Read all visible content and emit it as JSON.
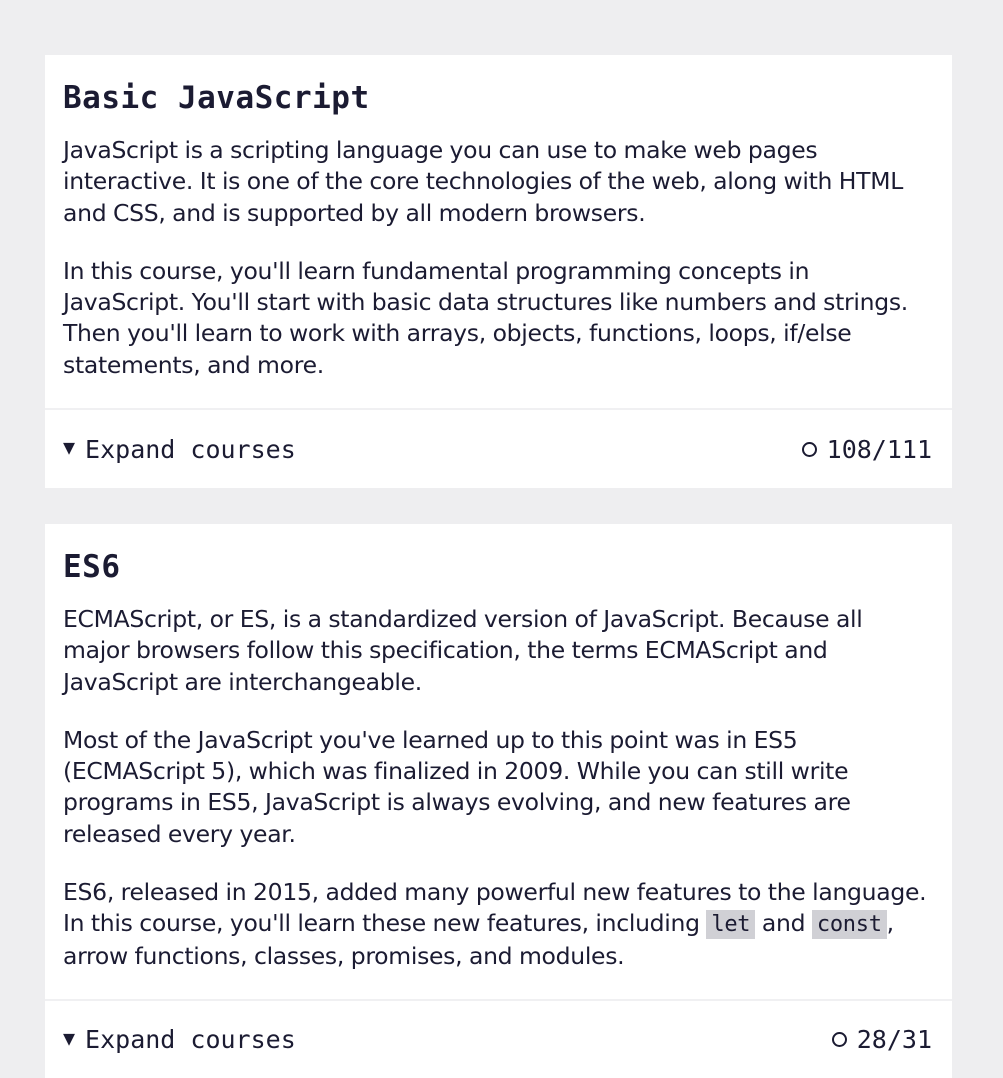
{
  "courses": [
    {
      "title": "Basic JavaScript",
      "paragraphs": [
        "JavaScript is a scripting language you can use to make web pages interactive. It is one of the core technologies of the web, along with HTML and CSS, and is supported by all modern browsers.",
        "In this course, you'll learn fundamental programming concepts in JavaScript. You'll start with basic data structures like numbers and strings. Then you'll learn to work with arrays, objects, functions, loops, if/else statements, and more."
      ],
      "expand_label": "Expand courses",
      "progress": "108/111"
    },
    {
      "title": "ES6",
      "paragraphs": [
        "ECMAScript, or ES, is a standardized version of JavaScript. Because all major browsers follow this specification, the terms ECMAScript and JavaScript are interchangeable.",
        "Most of the JavaScript you've learned up to this point was in ES5 (ECMAScript 5), which was finalized in 2009. While you can still write programs in ES5, JavaScript is always evolving, and new features are released every year."
      ],
      "p3": {
        "before": "ES6, released in 2015, added many powerful new features to the language. In this course, you'll learn these new features, including ",
        "code1": "let",
        "mid": " and ",
        "code2": "const",
        "after": ", arrow functions, classes, promises, and modules."
      },
      "expand_label": "Expand courses",
      "progress": "28/31"
    }
  ],
  "icons": {
    "expand": "triangle-down-icon",
    "progress": "circle-outline-icon"
  },
  "colors": {
    "page_bg": "#eeeef0",
    "card_bg": "#ffffff",
    "text": "#1b1b32",
    "code_bg": "#d0d0d5"
  }
}
